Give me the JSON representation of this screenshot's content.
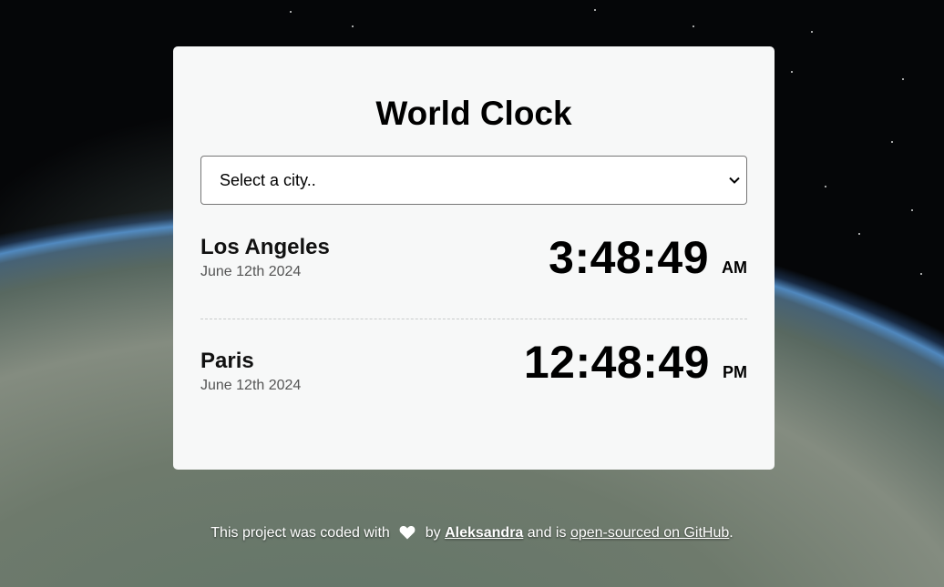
{
  "app": {
    "title": "World Clock"
  },
  "search": {
    "selected": "Select a city.."
  },
  "cities": [
    {
      "name": "Los Angeles",
      "date": "June 12th 2024",
      "time": "3:48:49",
      "period": "AM"
    },
    {
      "name": "Paris",
      "date": "June 12th 2024",
      "time": "12:48:49",
      "period": "PM"
    }
  ],
  "footer": {
    "prefix": "This project was coded with",
    "by": "by",
    "author": "Aleksandra",
    "middle": "and is",
    "link": "open-sourced on GitHub",
    "suffix": "."
  },
  "colors": {
    "card_background": "#f7f8f8",
    "text": "#000000",
    "muted_text": "#555555",
    "divider": "#c9cccc"
  },
  "icons": {
    "dropdown": "chevron-down-icon",
    "footer": "heart-icon"
  }
}
